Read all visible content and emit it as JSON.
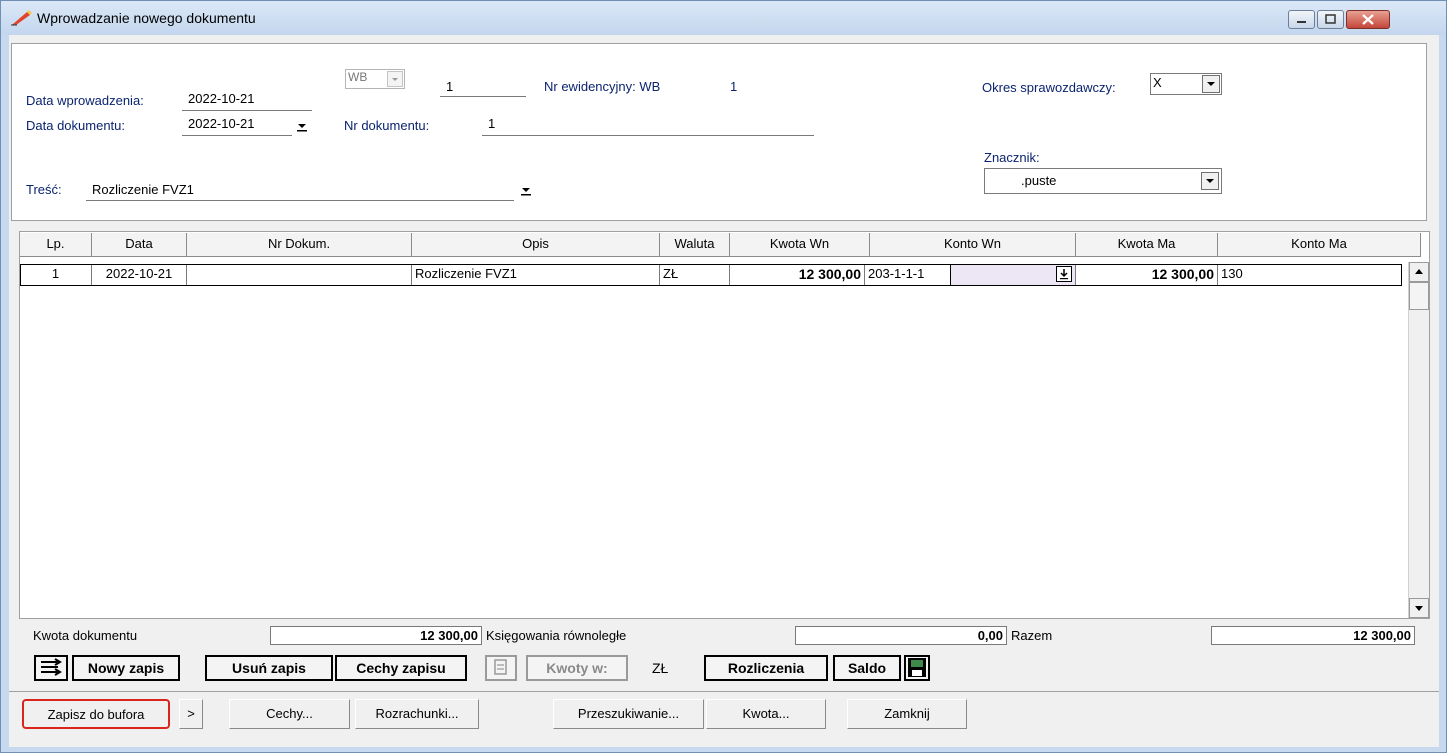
{
  "window": {
    "title": "Wprowadzanie nowego dokumentu"
  },
  "header": {
    "data_wprowadzenia_label": "Data wprowadzenia:",
    "data_wprowadzenia_value": "2022-10-21",
    "data_dokumentu_label": "Data dokumentu:",
    "data_dokumentu_value": "2022-10-21",
    "register_select_value": "WB",
    "register_number": "1",
    "nr_ewidencyjny_label": "Nr ewidencyjny: WB",
    "nr_ewidencyjny_value": "1",
    "nr_dokumentu_label": "Nr dokumentu:",
    "nr_dokumentu_value": "1",
    "okres_label": "Okres sprawozdawczy:",
    "okres_value": "X",
    "znacznik_label": "Znacznik:",
    "znacznik_value": ".puste",
    "tresc_label": "Treść:",
    "tresc_value": "Rozliczenie FVZ1"
  },
  "grid": {
    "columns": [
      "Lp.",
      "Data",
      "Nr Dokum.",
      "Opis",
      "Waluta",
      "Kwota Wn",
      "Konto Wn",
      "Kwota Ma",
      "Konto Ma"
    ],
    "rows": [
      {
        "lp": "1",
        "data": "2022-10-21",
        "nr_dokum": "",
        "opis": "Rozliczenie FVZ1",
        "waluta": "ZŁ",
        "kwota_wn": "12 300,00",
        "konto_wn": "203-1-1-1",
        "kwota_ma": "12 300,00",
        "konto_ma": "130"
      }
    ]
  },
  "totals": {
    "kwota_dokumentu_label": "Kwota dokumentu",
    "kwota_dokumentu_value": "12 300,00",
    "ksiegowania_label": "Księgowania równoległe",
    "ksiegowania_value": "0,00",
    "razem_label": "Razem",
    "razem_value": "12 300,00"
  },
  "toolbar": {
    "nowy_zapis": "Nowy zapis",
    "usun_zapis": "Usuń zapis",
    "cechy_zapisu": "Cechy zapisu",
    "kwoty_w": "Kwoty w:",
    "currency": "ZŁ",
    "rozliczenia": "Rozliczenia",
    "saldo": "Saldo"
  },
  "footer": {
    "zapisz": "Zapisz do bufora",
    "more": ">",
    "cechy": "Cechy...",
    "rozrachunki": "Rozrachunki...",
    "przeszukiwanie": "Przeszukiwanie...",
    "kwota": "Kwota...",
    "zamknij": "Zamknij"
  },
  "colors": {
    "label_blue": "#0b2470",
    "highlight_red": "#d9251c",
    "titlebar": "#c7d9ef"
  },
  "icons": [
    "pen-icon",
    "minimize-icon",
    "maximize-icon",
    "close-icon",
    "dropdown-arrow-icon",
    "list-icon",
    "save-icon",
    "calculator-icon"
  ]
}
